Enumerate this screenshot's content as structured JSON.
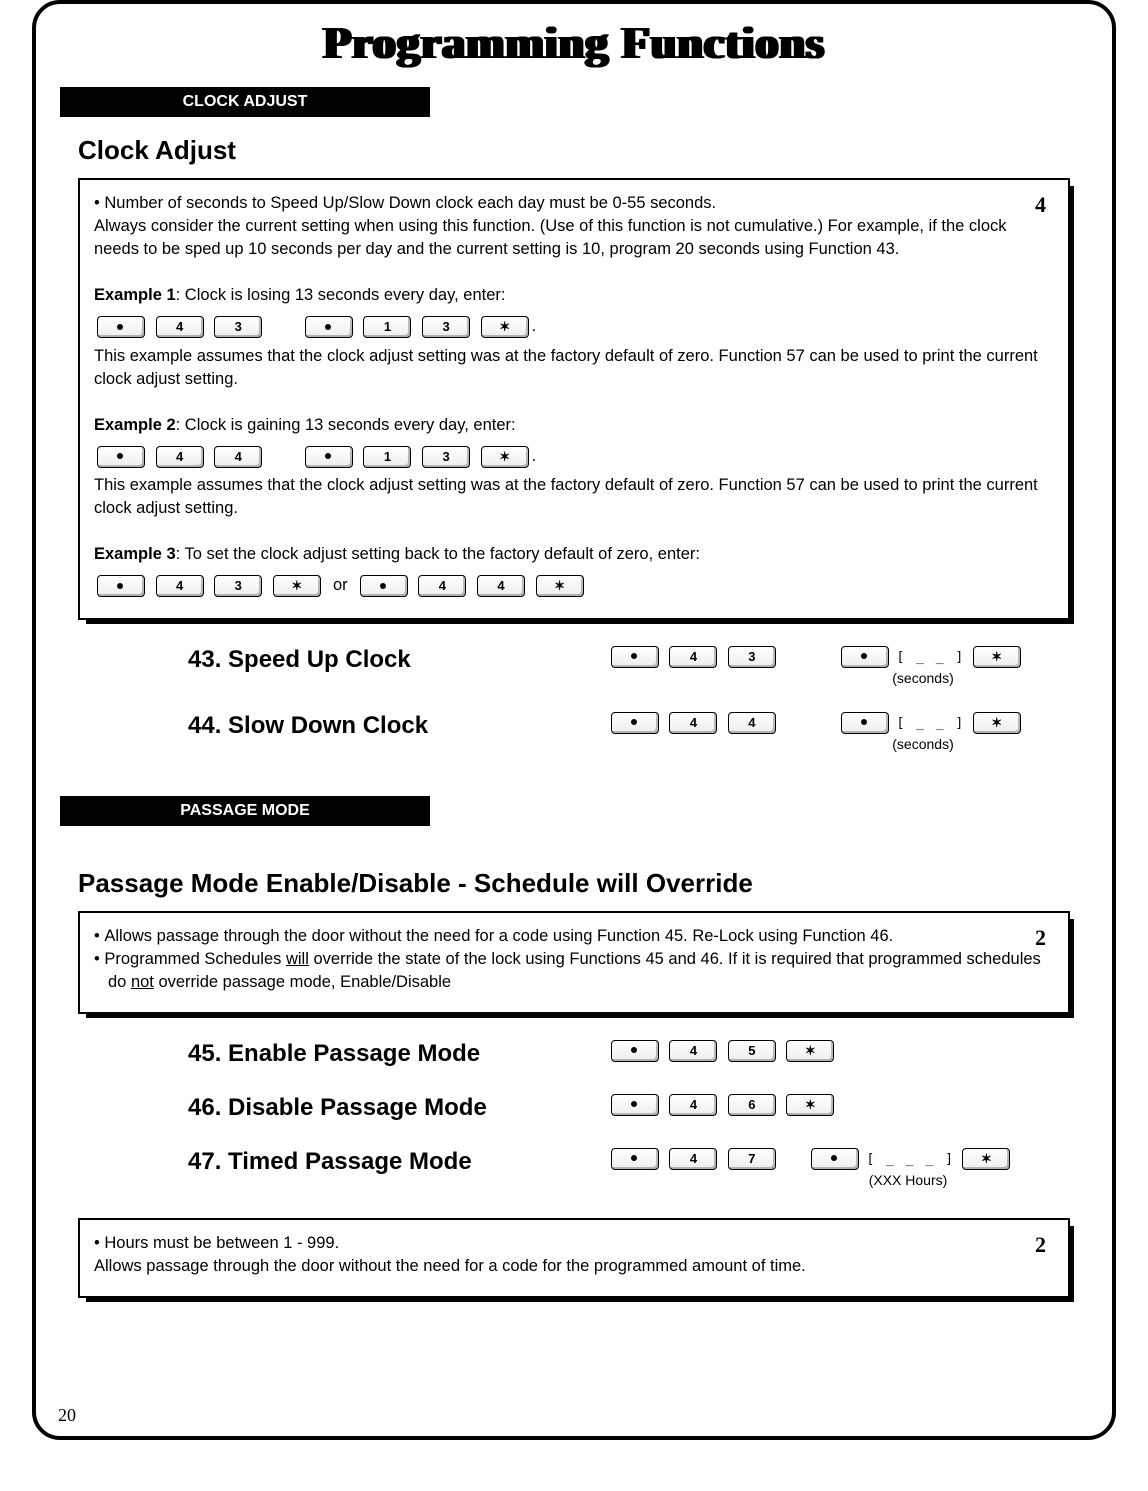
{
  "title": "Programming Functions",
  "page_number": "20",
  "sections": {
    "clock": {
      "tab": "CLOCK ADJUST",
      "heading": "Clock Adjust",
      "corner": "4",
      "intro_bullet": "Number of seconds to Speed Up/Slow Down clock each day must be 0-55 seconds.",
      "intro_rest": "Always consider the current setting when using this function.  (Use of this function is not cumulative.)  For example, if the clock needs to be sped up 10 seconds per day and the current setting is 10, program 20 seconds using Function 43.",
      "ex1_label": "Example 1",
      "ex1_text": ": Clock is losing 13 seconds every day, enter:",
      "ex_note": "This example assumes that the clock adjust setting was at the factory default of zero. Function 57 can be used to print the current clock adjust setting.",
      "ex2_label": "Example 2",
      "ex2_text": ": Clock is gaining 13 seconds every day, enter:",
      "ex3_label": "Example 3",
      "ex3_text": ": To set the clock adjust setting back to the factory default of zero, enter:",
      "or_word": "or",
      "period": ".",
      "keys": {
        "prog": "",
        "n1": "1",
        "n3": "3",
        "n4": "4",
        "n7": "7",
        "star": "✶"
      },
      "func43": "43. Speed Up Clock",
      "func44": "44. Slow Down Clock",
      "seconds_caption": "(seconds)",
      "blank2": "[ _  _ ]"
    },
    "passage": {
      "tab": "PASSAGE MODE",
      "heading": "Passage Mode Enable/Disable - Schedule will Override",
      "corner": "2",
      "bullet1": "Allows passage through the door without the need for a code using Function 45.   Re-Lock using Function 46.",
      "bullet2_a": "Programmed Schedules ",
      "bullet2_will": "will",
      "bullet2_b": " override the state of the lock using Functions 45 and 46.  If it is required that programmed schedules do ",
      "bullet2_not": "not",
      "bullet2_c": " override passage mode, Enable/Disable",
      "func45": "45. Enable Passage Mode",
      "func46": "46. Disable Passage Mode",
      "func47": "47. Timed Passage Mode",
      "blank3": "[ _ _ _ ]",
      "hours_caption": "(XXX Hours)",
      "keys": {
        "n4": "4",
        "n5": "5",
        "n6": "6",
        "n7": "7",
        "star": "✶"
      },
      "box2_corner": "2",
      "box2_bullet": "Hours must be between 1 - 999.",
      "box2_rest": "Allows passage through the door without the need for a code for the programmed amount of time."
    }
  }
}
